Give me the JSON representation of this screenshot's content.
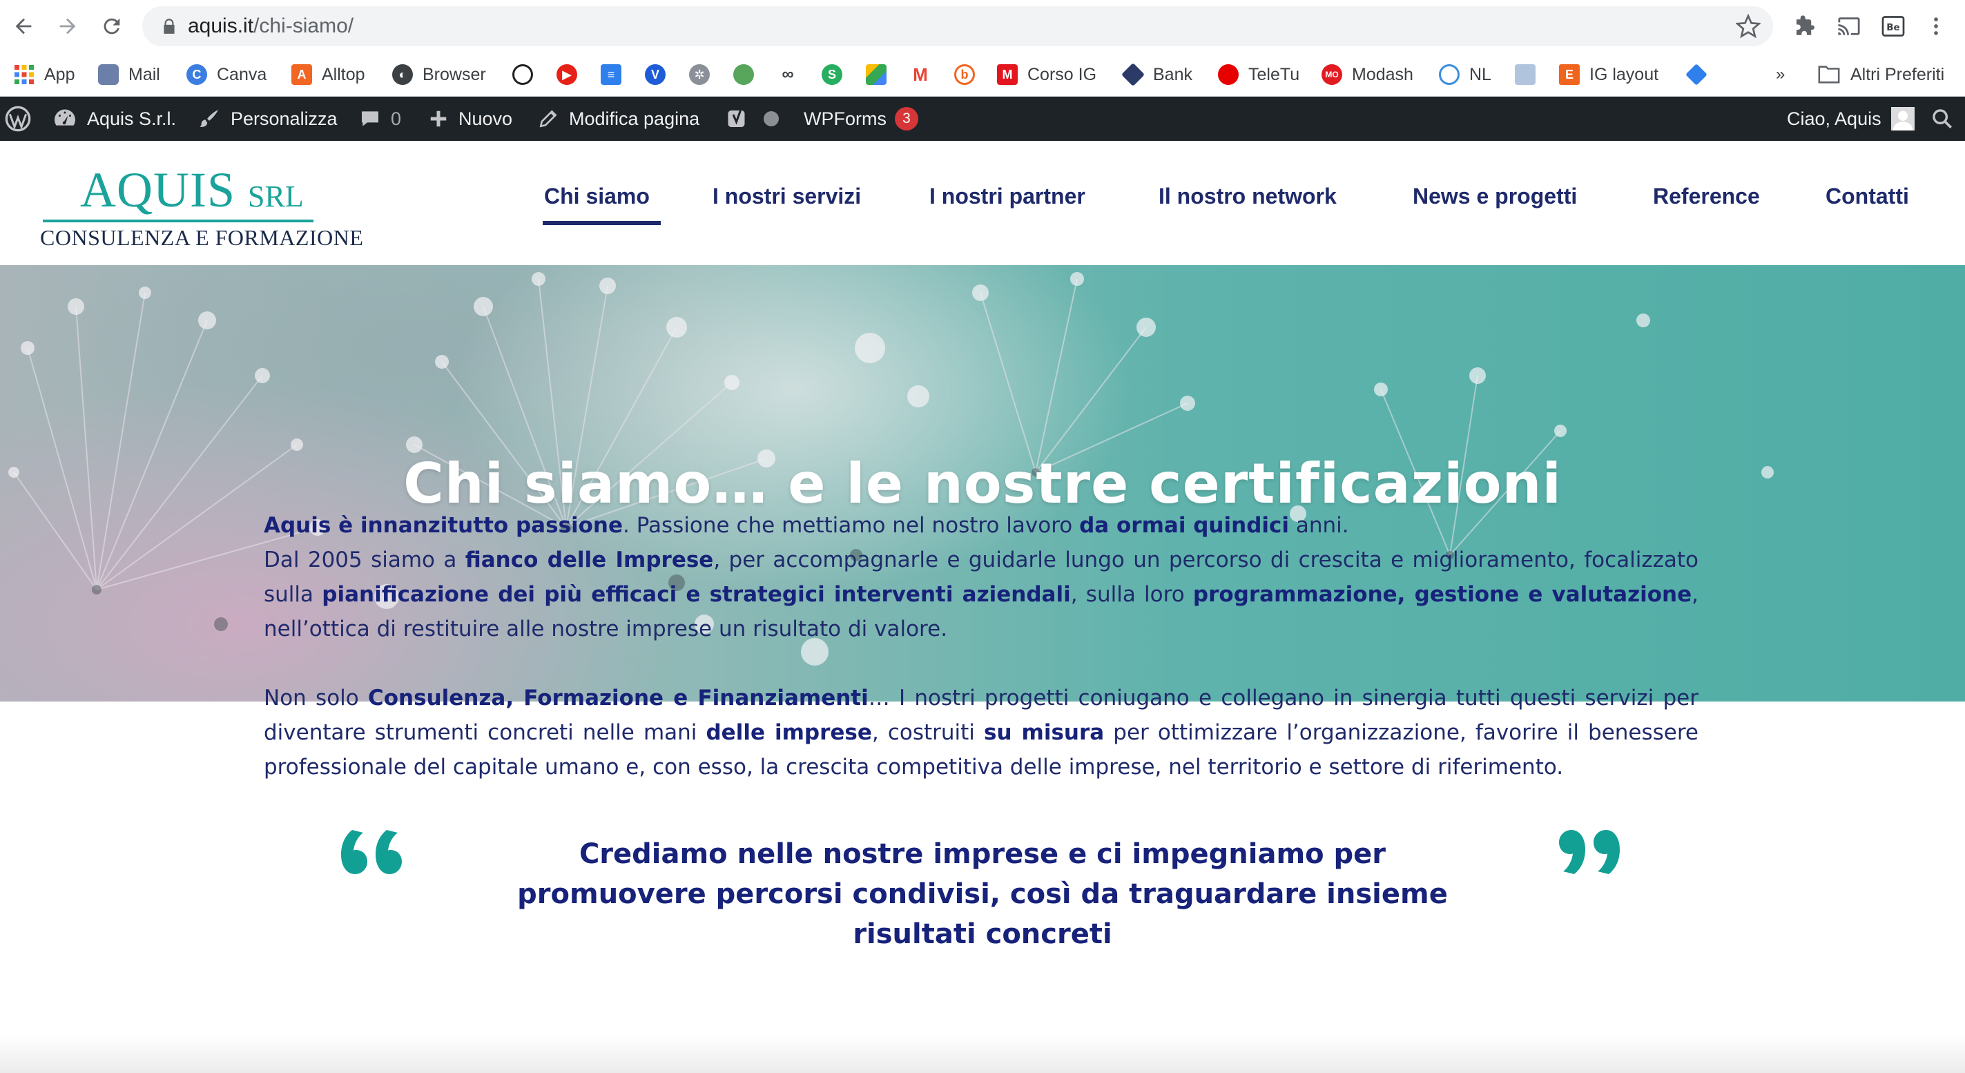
{
  "browser": {
    "url_host": "aquis.it",
    "url_path": "/chi-siamo/"
  },
  "bookmarks": {
    "items": [
      {
        "label": "App",
        "icon": "apps-grid-icon"
      },
      {
        "label": "Mail",
        "icon": "mail-cube-icon"
      },
      {
        "label": "Canva",
        "icon": "canva-icon"
      },
      {
        "label": "Alltop",
        "icon": "alltop-icon"
      },
      {
        "label": "Browser",
        "icon": "globe-icon"
      },
      {
        "label": "Corso IG",
        "icon": "corso-icon"
      },
      {
        "label": "Bank",
        "icon": "bank-icon"
      },
      {
        "label": "TeleTu",
        "icon": "vodafone-icon"
      },
      {
        "label": "Modash",
        "icon": "modash-icon"
      },
      {
        "label": "NL",
        "icon": "nl-icon"
      },
      {
        "label": "IG layout",
        "icon": "etsy-icon"
      }
    ],
    "overflow": "»",
    "other_folder": "Altri Preferiti"
  },
  "adminbar": {
    "site": "Aquis S.r.l.",
    "customize": "Personalizza",
    "comments": "0",
    "new": "Nuovo",
    "edit": "Modifica pagina",
    "wpforms": "WPForms",
    "wpforms_count": "3",
    "greeting": "Ciao, Aquis"
  },
  "logo": {
    "name": "AQUIS",
    "suffix": "SRL",
    "tagline": "CONSULENZA E FORMAZIONE"
  },
  "menu": {
    "items": [
      "Chi siamo",
      "I nostri servizi",
      "I nostri partner",
      "Il nostro network",
      "News e progetti",
      "Reference",
      "Contatti"
    ]
  },
  "hero": {
    "title": "Chi siamo… e le nostre certificazioni"
  },
  "content": {
    "p1": [
      {
        "t": "Aquis è innanzitutto passione",
        "b": true
      },
      {
        "t": ". Passione che mettiamo nel nostro lavoro ",
        "b": false
      },
      {
        "t": "da ormai quindici",
        "b": true
      },
      {
        "t": " anni.",
        "b": false
      }
    ],
    "p2": [
      {
        "t": "Dal 2005 siamo a ",
        "b": false
      },
      {
        "t": "fianco delle Imprese",
        "b": true
      },
      {
        "t": ", per accompagnarle e guidarle lungo un percorso di crescita e miglioramento, focalizzato sulla ",
        "b": false
      },
      {
        "t": "pianificazione dei più efficaci e strategici interventi aziendali",
        "b": true
      },
      {
        "t": ", sulla loro ",
        "b": false
      },
      {
        "t": "programmazione, gestione e valutazione",
        "b": true
      },
      {
        "t": ", nell’ottica di restituire alle nostre imprese un risultato di valore.",
        "b": false
      }
    ],
    "p3": [
      {
        "t": "Non solo ",
        "b": false
      },
      {
        "t": "Consulenza, Formazione e Finanziamenti",
        "b": true
      },
      {
        "t": "… I nostri progetti coniugano e collegano in sinergia tutti questi servizi per diventare strumenti concreti nelle mani ",
        "b": false
      },
      {
        "t": "delle imprese",
        "b": true
      },
      {
        "t": ", costruiti ",
        "b": false
      },
      {
        "t": "su misura",
        "b": true
      },
      {
        "t": " per ottimizzare l’organizzazione, favorire il benessere professionale del capitale umano e, con esso, la crescita competitiva delle imprese, nel territorio e settore di riferimento.",
        "b": false
      }
    ]
  },
  "quote": {
    "text": "Crediamo nelle nostre imprese e ci impegniamo per promuovere percorsi condivisi, così da traguardare insieme risultati concreti"
  },
  "colors": {
    "brand_teal": "#1aa39a",
    "navy": "#1f2a6b",
    "adminbar": "#1d2327",
    "quote_mark": "#12a095"
  }
}
